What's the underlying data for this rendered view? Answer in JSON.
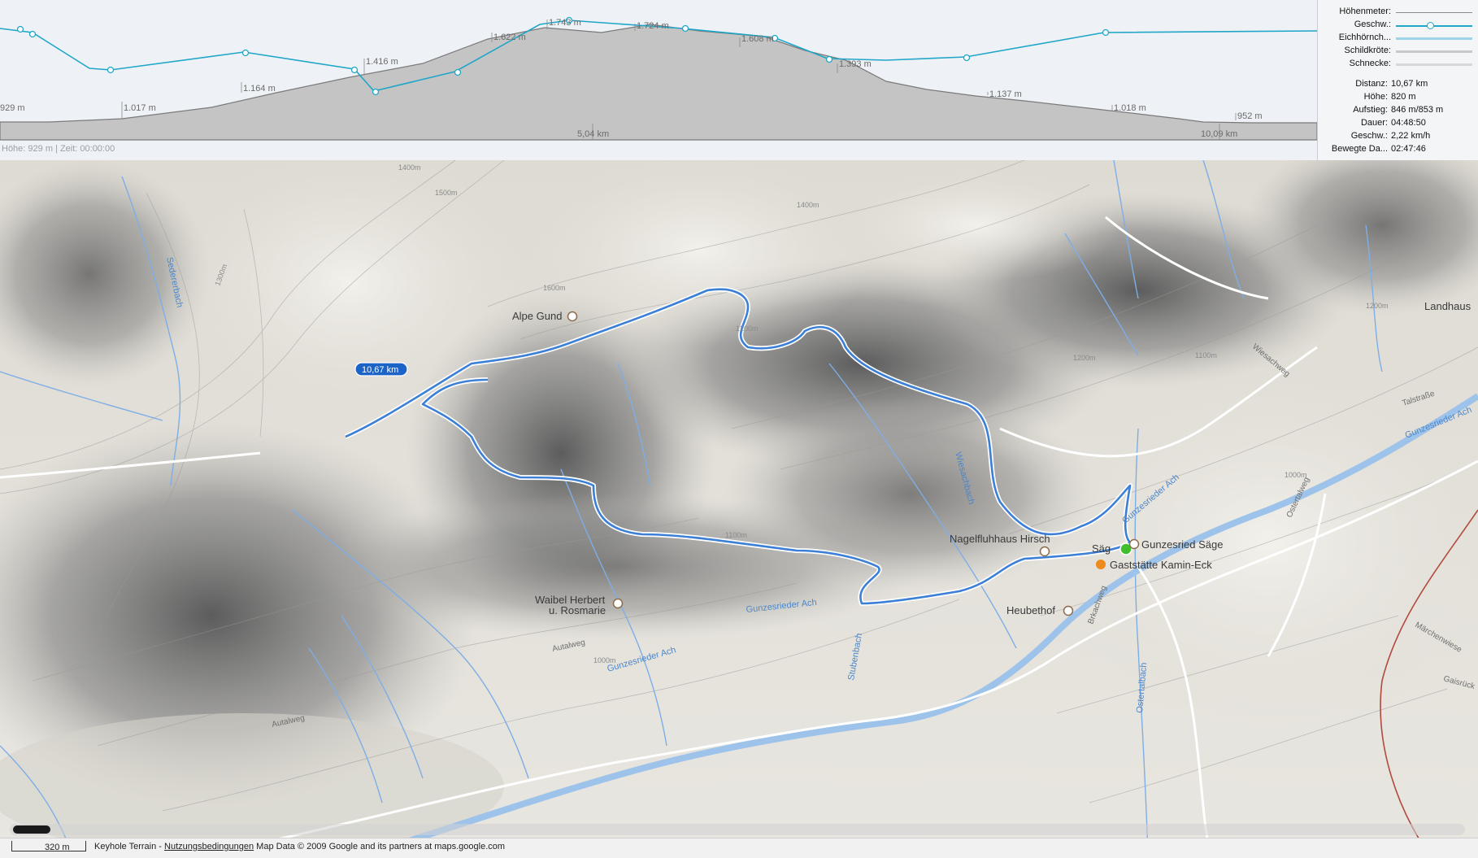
{
  "profile": {
    "elevation_labels": [
      "929 m",
      "1.017 m",
      "1.164 m",
      "1.416 m",
      "1.622 m",
      "1.743 m",
      "1.724 m",
      "1.608 m",
      "1.393 m",
      "1.137 m",
      "1.018 m",
      "952 m"
    ],
    "distance_labels": [
      "5,04 km",
      "10,09 km"
    ],
    "status": "Höhe: 929 m | Zeit: 00:00:00",
    "elevation_color": "#b9b9b9",
    "speed_color": "#1fa6c8"
  },
  "legend": {
    "items": [
      {
        "label": "Höhenmeter:",
        "color": "#8a8a8a"
      },
      {
        "label": "Geschw.:",
        "color": "#1fa6c8"
      },
      {
        "label": "Eichhörnch...",
        "color": "#9fd3e6"
      },
      {
        "label": "Schildkröte:",
        "color": "#c8c8c8"
      },
      {
        "label": "Schnecke:",
        "color": "#d8d8d8"
      }
    ],
    "stats": [
      {
        "label": "Distanz:",
        "value": "10,67 km"
      },
      {
        "label": "Höhe:",
        "value": "820 m"
      },
      {
        "label": "Aufstieg:",
        "value": "846 m/853 m"
      },
      {
        "label": "Dauer:",
        "value": "04:48:50"
      },
      {
        "label": "Geschw.:",
        "value": "2,22 km/h"
      },
      {
        "label": "Bewegte Da...",
        "value": "02:47:46"
      }
    ]
  },
  "map": {
    "route_distance_badge": "10,67 km",
    "route_color": "#3c7fd6",
    "pois": {
      "alpe_gund": "Alpe Gund",
      "nagelfluhhaus": "Nagelfluhhaus Hirsch",
      "gunzesried_saege": "Gunzesried Säge",
      "gaststaette": "Gaststätte Kamin-Eck",
      "heubethof": "Heubethof",
      "waibel_line1": "Waibel Herbert",
      "waibel_line2": "u. Rosmarie",
      "landhaus": "Landhaus",
      "saege_short": "Säg"
    },
    "roads": {
      "autalweg": "Autalweg",
      "talstrasse": "Talstraße",
      "wiesachweg": "Wiesachweg",
      "ostertalweg": "Ostertalweg",
      "maerchenwiese": "Märchenwiese",
      "gaisrueck": "Gaisrück",
      "brkachweg": "Brkachweg"
    },
    "waters": {
      "gunzesrieder_ach": "Gunzesrieder Ach",
      "sederebach": "Sedererbach",
      "wiesachbach": "Wiesachbach",
      "ostertalbach": "Ostertalbach",
      "stubenbach": "Stubenbach"
    },
    "contour_labels": [
      "1400m",
      "1500m",
      "1600m",
      "1300m",
      "1200m",
      "1100m",
      "1000m"
    ]
  },
  "footer": {
    "scale": "320 m",
    "attribution_prefix": "Keyhole Terrain - ",
    "terms_link": "Nutzungsbedingungen",
    "attribution_suffix": " Map Data © 2009 Google and its partners at maps.google.com"
  }
}
